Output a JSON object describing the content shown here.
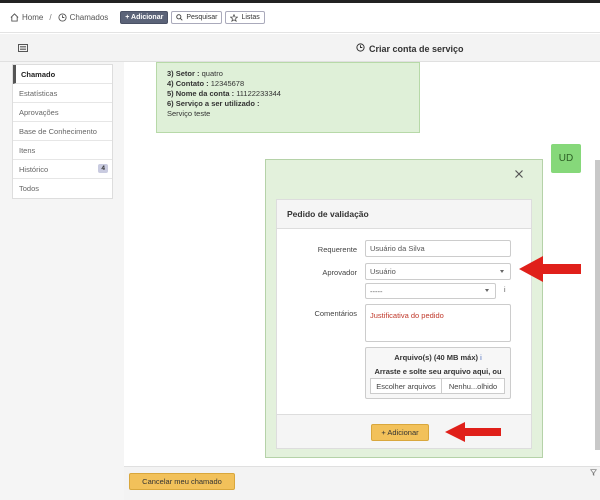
{
  "nav": {
    "home": "Home",
    "separator": "/",
    "tickets": "Chamados",
    "add_button": "+ Adicionar",
    "search_button": "Pesquisar",
    "lists_button": "Listas"
  },
  "header": {
    "title": "Criar conta de serviço"
  },
  "sidebar": {
    "items": [
      {
        "label": "Chamado"
      },
      {
        "label": "Estatísticas"
      },
      {
        "label": "Aprovações"
      },
      {
        "label": "Base de Conhecimento"
      },
      {
        "label": "Itens"
      },
      {
        "label": "Histórico",
        "badge": "4"
      },
      {
        "label": "Todos"
      }
    ]
  },
  "ticket": {
    "line1_label": "3) Setor :",
    "line1_value": "quatro",
    "line2_label": "4) Contato :",
    "line2_value": "12345678",
    "line3_label": "5) Nome da conta :",
    "line3_value": "11122233344",
    "line4_label": "6) Serviço a ser utilizado :",
    "line4_value": "Serviço teste"
  },
  "avatar": {
    "initials": "UD",
    "color": "#86d87a"
  },
  "modal": {
    "title": "Pedido de validação",
    "requester_label": "Requerente",
    "requester_value": "Usuário da Silva",
    "approver_label": "Aprovador",
    "approver_value": "Usuário",
    "approver2_value": "-----",
    "info_icon": "i",
    "comments_label": "Comentários",
    "comments_value": "Justificativa do pedido",
    "upload_title": "Arquivo(s) (40 MB máx)",
    "upload_info": "i",
    "upload_hint": "Arraste e solte seu arquivo aqui, ou",
    "choose_files": "Escolher arquivos",
    "no_file": "Nenhu...olhido",
    "submit_button": "+ Adicionar"
  },
  "footer": {
    "cancel_button": "Cancelar meu chamado"
  },
  "colors": {
    "accent_green": "#dff0d8",
    "button_yellow": "#f2c15a",
    "arrow_red": "#e0201a"
  }
}
